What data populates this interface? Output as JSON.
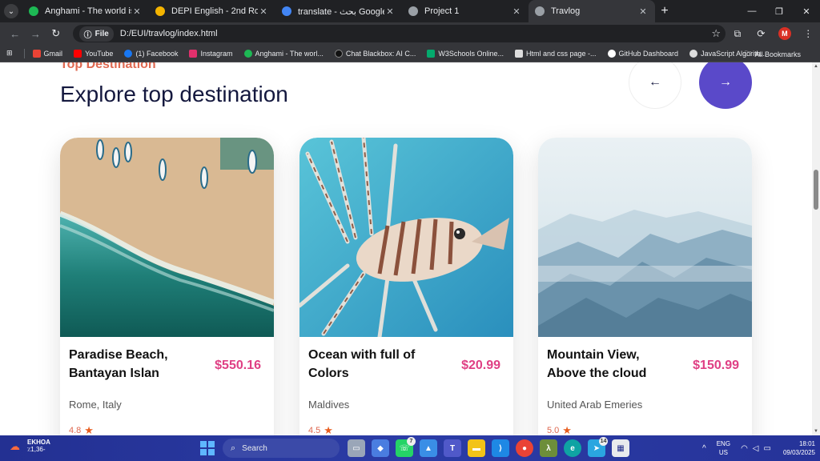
{
  "browser": {
    "tabs": [
      {
        "title": "Anghami - The world is listening",
        "color": "#1db954",
        "active": false
      },
      {
        "title": "DEPI English - 2nd Round - Go",
        "color": "#f4b400",
        "active": false
      },
      {
        "title": "translate - بحث Google",
        "color": "#4285f4",
        "active": false
      },
      {
        "title": "Project 1",
        "color": "#9aa0a6",
        "active": false
      },
      {
        "title": "Travlog",
        "color": "#9aa0a6",
        "active": true
      }
    ],
    "new_tab": "+",
    "address": {
      "chip": "File",
      "url": "D:/EUI/travlog/index.html"
    },
    "profile_initial": "M",
    "bookmarks": [
      {
        "label": "Gmail",
        "color": "#ea4335"
      },
      {
        "label": "YouTube",
        "color": "#ff0000"
      },
      {
        "label": "(1) Facebook",
        "color": "#1877f2"
      },
      {
        "label": "Instagram",
        "color": "#e1306c"
      },
      {
        "label": "Anghami - The worl...",
        "color": "#1db954"
      },
      {
        "label": "Chat Blackbox: AI C...",
        "color": "#111111"
      },
      {
        "label": "W3Schools Online...",
        "color": "#04aa6d"
      },
      {
        "label": "Html and css page -...",
        "color": "#dddddd"
      },
      {
        "label": "GitHub Dashboard",
        "color": "#ffffff"
      },
      {
        "label": "JavaScript Algorith...",
        "color": "#dddddd"
      }
    ],
    "all_bookmarks": "All Bookmarks"
  },
  "page": {
    "subtitle": "Top Destination",
    "heading": "Explore top destination",
    "prev_arrow": "←",
    "next_arrow": "→",
    "cards": [
      {
        "name": "Paradise Beach, Bantayan Islan",
        "price": "$550.16",
        "location": "Rome, Italy",
        "rating": "4.8",
        "image": "beach"
      },
      {
        "name": "Ocean with full of Colors",
        "price": "$20.99",
        "location": "Maldives",
        "rating": "4.5",
        "image": "lionfish"
      },
      {
        "name": "Mountain View, Above the cloud",
        "price": "$150.99",
        "location": "United Arab Emeries",
        "rating": "5.0",
        "image": "mountains"
      }
    ]
  },
  "taskbar": {
    "weather_title": "EKHOA",
    "weather_sub": "٪1,36-",
    "search_placeholder": "Search",
    "whatsapp_badge": "7",
    "telegram_badge": "14",
    "lang": "ENG",
    "region": "US",
    "time": "18:01",
    "date": "09/03/2025"
  }
}
